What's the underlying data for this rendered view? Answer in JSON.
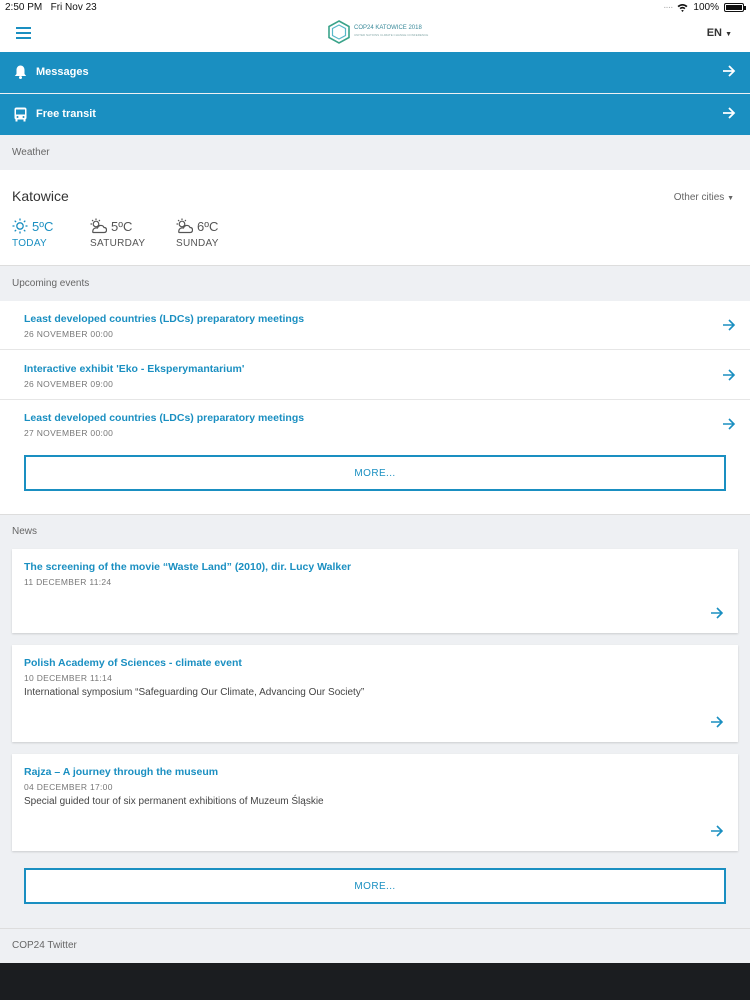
{
  "status": {
    "time": "2:50 PM",
    "date": "Fri Nov 23",
    "battery": "100%"
  },
  "header": {
    "logo_title": "COP24 KATOWICE 2018",
    "logo_sub": "UNITED NATIONS CLIMATE CHANGE CONFERENCE",
    "language": "EN"
  },
  "banners": {
    "messages": "Messages",
    "transit": "Free transit"
  },
  "weather": {
    "section": "Weather",
    "city": "Katowice",
    "other_cities": "Other cities",
    "days": [
      {
        "temp": "5ºC",
        "label": "TODAY",
        "icon": "sun-icon"
      },
      {
        "temp": "5ºC",
        "label": "SATURDAY",
        "icon": "partly-cloudy-icon"
      },
      {
        "temp": "6ºC",
        "label": "SUNDAY",
        "icon": "partly-cloudy-icon"
      }
    ]
  },
  "events": {
    "section": "Upcoming events",
    "items": [
      {
        "title": "Least developed countries (LDCs) preparatory meetings",
        "date": "26 NOVEMBER 00:00"
      },
      {
        "title": "Interactive exhibit 'Eko - Eksperymantarium'",
        "date": "26 NOVEMBER 09:00"
      },
      {
        "title": "Least developed countries (LDCs) preparatory meetings",
        "date": "27 NOVEMBER 00:00"
      }
    ],
    "more": "MORE..."
  },
  "news": {
    "section": "News",
    "items": [
      {
        "title": "The screening of the movie “Waste Land” (2010), dir. Lucy Walker",
        "date": "11 DECEMBER 11:24",
        "desc": ""
      },
      {
        "title": "Polish Academy of Sciences - climate event",
        "date": "10 DECEMBER 11:14",
        "desc": "International symposium “Safeguarding Our Climate, Advancing Our Society”"
      },
      {
        "title": "Rajza – A journey through the museum",
        "date": "04 DECEMBER 17:00",
        "desc": "Special guided tour of six permanent exhibitions of Muzeum Śląskie"
      }
    ],
    "more": "MORE..."
  },
  "twitter": {
    "section": "COP24 Twitter"
  },
  "colors": {
    "accent": "#1a8fc1",
    "background": "#eef0f3"
  }
}
